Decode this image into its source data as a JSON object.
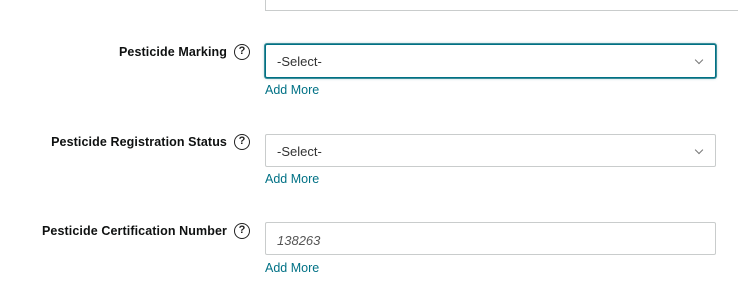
{
  "fields": [
    {
      "label": "Pesticide Marking",
      "help_icon_glyph": "?",
      "type": "select",
      "value": "-Select-",
      "add_more_label": "Add More",
      "focused": true
    },
    {
      "label": "Pesticide Registration Status",
      "help_icon_glyph": "?",
      "type": "select",
      "value": "-Select-",
      "add_more_label": "Add More",
      "focused": false
    },
    {
      "label": "Pesticide Certification Number",
      "help_icon_glyph": "?",
      "type": "text",
      "placeholder": "138263",
      "add_more_label": "Add More",
      "focused": false
    }
  ],
  "colors": {
    "link": "#007185",
    "focus_border": "#007185",
    "input_border": "#c9cccc",
    "label_text": "#0f1111"
  },
  "icons": {
    "help": "help-circle-icon",
    "dropdown": "chevron-down-icon"
  }
}
